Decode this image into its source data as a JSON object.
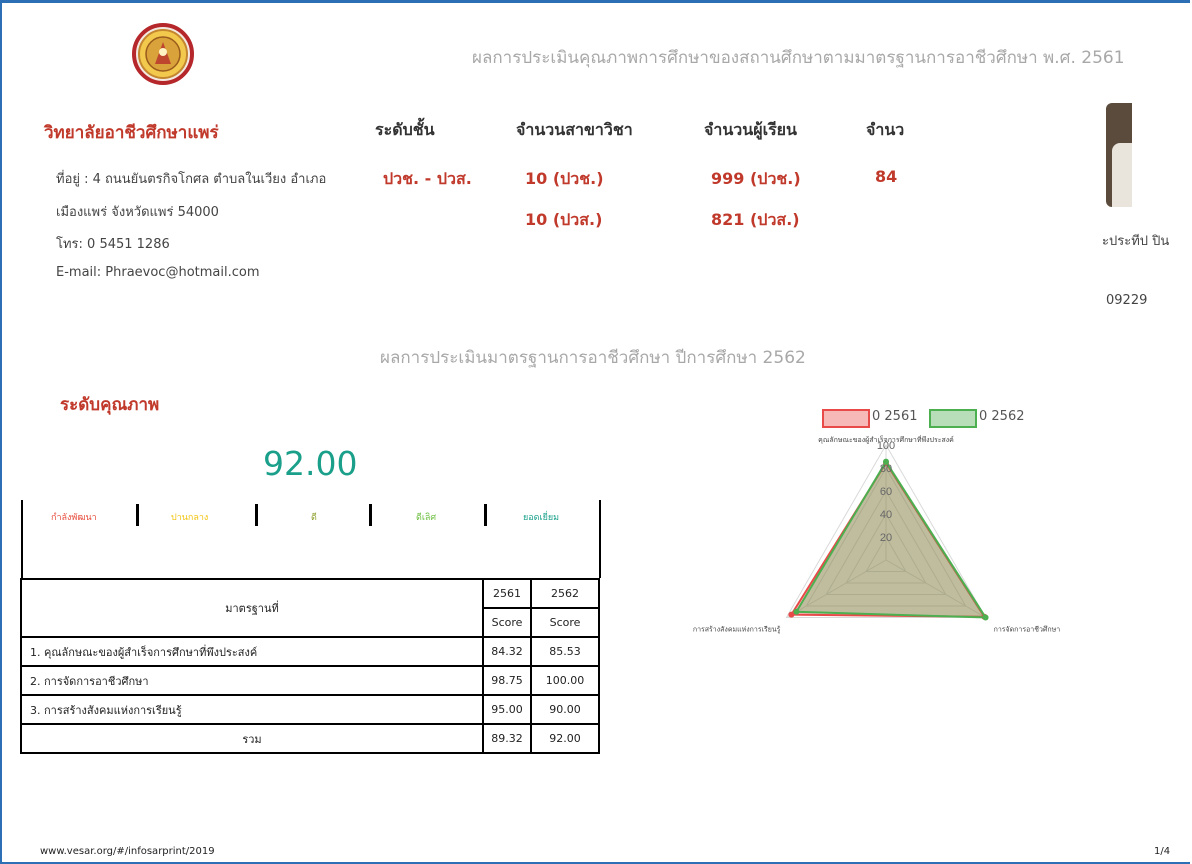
{
  "header": {
    "report_title": "ผลการประเมินคุณภาพการศึกษาของสถานศึกษาตามมาตรฐานการอาชีวศึกษา พ.ศ. 2561"
  },
  "college": {
    "name": "วิทยาลัยอาชีวศึกษาแพร่",
    "address_line1": "ที่อยู่ : 4 ถนนยันตรกิจโกศล ตำบลในเวียง อำเภอ",
    "address_line2": "เมืองแพร่ จังหวัดแพร่ 54000",
    "phone": "โทร: 0 5451 1286",
    "email": "E-mail: Phraevoc@hotmail.com"
  },
  "stats": {
    "level_header": "ระดับชั้น",
    "branches_header": "จำนวนสาขาวิชา",
    "students_header": "จำนวนผู้เรียน",
    "cut_header": "จำนว",
    "level_value": "ปวช. - ปวส.",
    "branches_1": "10 (ปวช.)",
    "branches_2": "10 (ปวส.)",
    "students_1": "999 (ปวช.)",
    "students_2": "821 (ปวส.)",
    "cut_value": "84"
  },
  "director": {
    "name_fragment": "ะประทีป ปิน",
    "phone_fragment": "09229"
  },
  "assessment": {
    "section_title": "ผลการประเมินมาตรฐานการอาชีวศึกษา ปีการศึกษา 2562",
    "quality_label": "ระดับคุณภาพ",
    "score": "92.00",
    "levels": [
      {
        "label": "กำลังพัฒนา",
        "color": "#e74c3c"
      },
      {
        "label": "ปานกลาง",
        "color": "#f1c40f"
      },
      {
        "label": "ดี",
        "color": "#8e9e2b"
      },
      {
        "label": "ดีเลิศ",
        "color": "#6cbf3f"
      },
      {
        "label": "ยอดเยี่ยม",
        "color": "#1aa08a"
      }
    ]
  },
  "table": {
    "col_standard": "มาตรฐานที่",
    "col_2561": "2561",
    "col_2562": "2562",
    "sub_score": "Score",
    "rows": [
      {
        "label": "1. คุณลักษณะของผู้สำเร็จการศึกษาที่พึงประสงค์",
        "s2561": "84.32",
        "s2562": "85.53"
      },
      {
        "label": "2. การจัดการอาชีวศึกษา",
        "s2561": "98.75",
        "s2562": "100.00"
      },
      {
        "label": "3. การสร้างสังคมแห่งการเรียนรู้",
        "s2561": "95.00",
        "s2562": "90.00"
      }
    ],
    "total_label": "รวม",
    "total_2561": "89.32",
    "total_2562": "92.00"
  },
  "chart_data": {
    "type": "radar",
    "categories": [
      "คุณลักษณะของผู้สำเร็จการศึกษาที่พึงประสงค์",
      "การจัดการอาชีวศึกษา",
      "การสร้างสังคมแห่งการเรียนรู้"
    ],
    "series": [
      {
        "name": "0 2561",
        "values": [
          84.32,
          98.75,
          95.0
        ],
        "color": "#e84a4a"
      },
      {
        "name": "0 2562",
        "values": [
          85.53,
          100.0,
          90.0
        ],
        "color": "#4caf50"
      }
    ],
    "ticks": [
      "20",
      "40",
      "60",
      "80",
      "100"
    ],
    "rlim": [
      0,
      100
    ],
    "legend_position": "top"
  },
  "footer": {
    "url": "www.vesar.org/#/infosarprint/2019",
    "page": "1/4"
  }
}
